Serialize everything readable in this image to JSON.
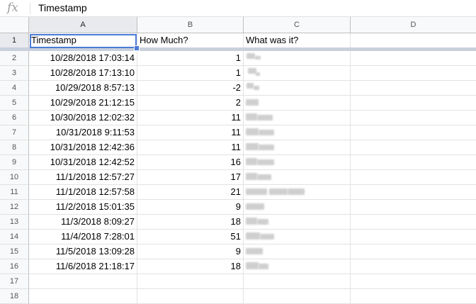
{
  "formula_bar": {
    "icon": "fx-icon",
    "value": "Timestamp"
  },
  "columns": [
    "A",
    "B",
    "C",
    "D"
  ],
  "header_row": {
    "row": "1",
    "a": "Timestamp",
    "b": "How Much?",
    "c": "What was it?"
  },
  "rows": [
    {
      "row": "2",
      "timestamp": "10/28/2018 17:03:14",
      "amount": "1"
    },
    {
      "row": "3",
      "timestamp": "10/28/2018 17:13:10",
      "amount": "1"
    },
    {
      "row": "4",
      "timestamp": "10/29/2018 8:57:13",
      "amount": "-2"
    },
    {
      "row": "5",
      "timestamp": "10/29/2018 21:12:15",
      "amount": "2"
    },
    {
      "row": "6",
      "timestamp": "10/30/2018 12:02:32",
      "amount": "11"
    },
    {
      "row": "7",
      "timestamp": "10/31/2018 9:11:53",
      "amount": "11"
    },
    {
      "row": "8",
      "timestamp": "10/31/2018 12:42:36",
      "amount": "11"
    },
    {
      "row": "9",
      "timestamp": "10/31/2018 12:42:52",
      "amount": "16"
    },
    {
      "row": "10",
      "timestamp": "11/1/2018 12:57:27",
      "amount": "17"
    },
    {
      "row": "11",
      "timestamp": "11/1/2018 12:57:58",
      "amount": "21"
    },
    {
      "row": "12",
      "timestamp": "11/2/2018 15:01:35",
      "amount": "9"
    },
    {
      "row": "13",
      "timestamp": "11/3/2018 8:09:27",
      "amount": "18"
    },
    {
      "row": "14",
      "timestamp": "11/4/2018 7:28:01",
      "amount": "51"
    },
    {
      "row": "15",
      "timestamp": "11/5/2018 13:09:28",
      "amount": "9"
    },
    {
      "row": "16",
      "timestamp": "11/6/2018 21:18:17",
      "amount": "18"
    }
  ],
  "empty_rows": [
    "17",
    "18"
  ],
  "colors": {
    "selection": "#4a7bd6",
    "header_bg": "#f8f9fa",
    "freeze_bar": "#c9d0db"
  }
}
